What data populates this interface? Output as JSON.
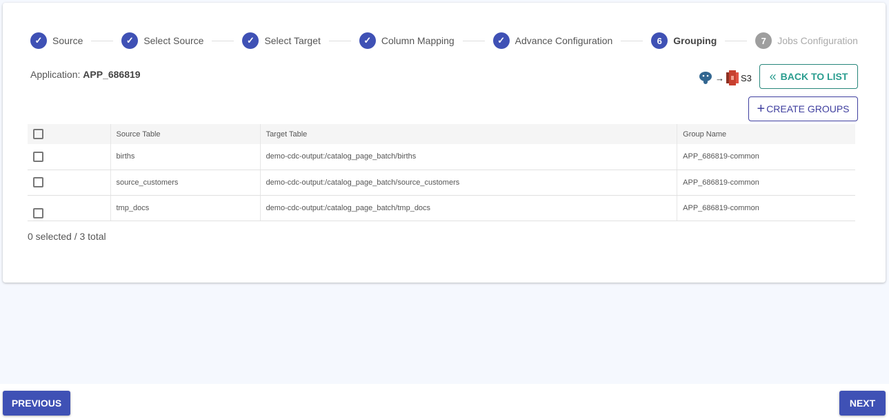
{
  "stepper": {
    "steps": [
      {
        "label": "Source",
        "state": "done"
      },
      {
        "label": "Select Source",
        "state": "done"
      },
      {
        "label": "Select Target",
        "state": "done"
      },
      {
        "label": "Column Mapping",
        "state": "done"
      },
      {
        "label": "Advance Configuration",
        "state": "done"
      },
      {
        "label": "Grouping",
        "state": "active",
        "number": "6"
      },
      {
        "label": "Jobs Configuration",
        "state": "pending",
        "number": "7"
      }
    ]
  },
  "application": {
    "label": "Application:",
    "name": "APP_686819"
  },
  "connection": {
    "source_icon": "postgresql-icon",
    "arrow": "→",
    "target_icon": "aws-s3-icon",
    "target_label": "S3"
  },
  "buttons": {
    "back": "BACK TO LIST",
    "create": "CREATE GROUPS",
    "previous": "PREVIOUS",
    "next": "NEXT"
  },
  "table": {
    "headers": [
      "Source Table",
      "Target Table",
      "Group Name"
    ],
    "rows": [
      [
        "births",
        "demo-cdc-output:/catalog_page_batch/births",
        "APP_686819-common"
      ],
      [
        "source_customers",
        "demo-cdc-output:/catalog_page_batch/source_customers",
        "APP_686819-common"
      ],
      [
        "tmp_docs",
        "demo-cdc-output:/catalog_page_batch/tmp_docs",
        "APP_686819-common"
      ]
    ]
  },
  "selection": "0 selected / 3 total",
  "colors": {
    "primary": "#3f51b5",
    "teal": "#2a9d8f",
    "background": "#f5f8fe"
  }
}
